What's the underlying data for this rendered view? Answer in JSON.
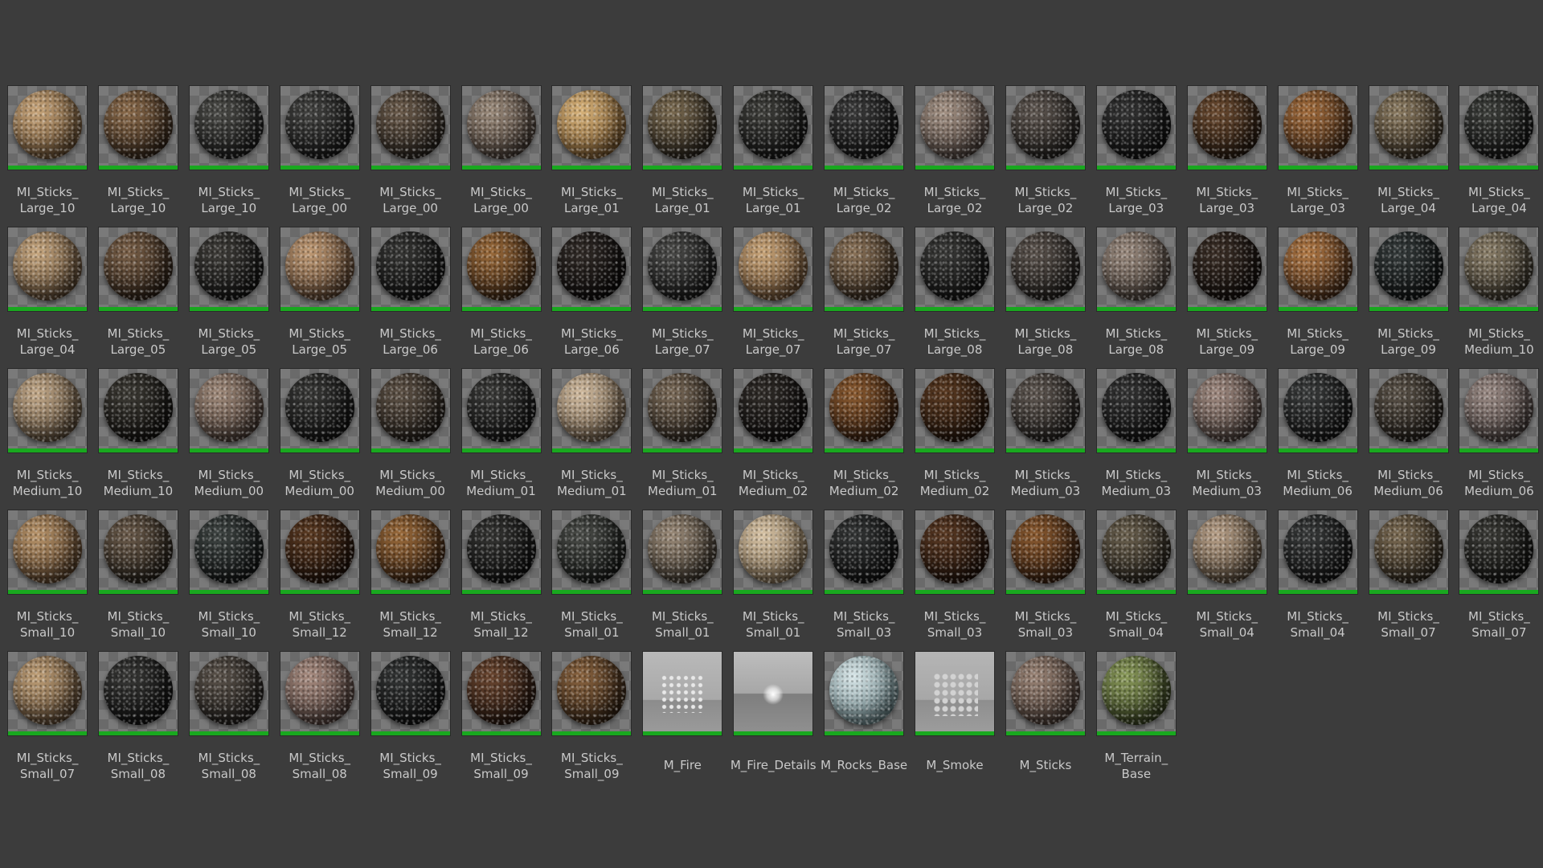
{
  "colors": {
    "background": "#3c3c3c",
    "label_text": "#c9c9c9",
    "asset_type_bar": "#19a81f"
  },
  "assets": [
    {
      "label": "MI_Sticks_\nLarge_10",
      "thumb": "sphere",
      "tone": [
        "#c8a57a",
        "#5b4329"
      ]
    },
    {
      "label": "MI_Sticks_\nLarge_10",
      "thumb": "sphere",
      "tone": [
        "#8a6a4a",
        "#2a1e14"
      ]
    },
    {
      "label": "MI_Sticks_\nLarge_10",
      "thumb": "sphere",
      "tone": [
        "#4a4a46",
        "#151515"
      ]
    },
    {
      "label": "MI_Sticks_\nLarge_00",
      "thumb": "sphere",
      "tone": [
        "#424240",
        "#121212"
      ]
    },
    {
      "label": "MI_Sticks_\nLarge_00",
      "thumb": "sphere",
      "tone": [
        "#6a5a4a",
        "#1e1a16"
      ]
    },
    {
      "label": "MI_Sticks_\nLarge_00",
      "thumb": "sphere",
      "tone": [
        "#9a8a7a",
        "#3a302a"
      ]
    },
    {
      "label": "MI_Sticks_\nLarge_01",
      "thumb": "sphere",
      "tone": [
        "#d8b37a",
        "#6a4a24"
      ]
    },
    {
      "label": "MI_Sticks_\nLarge_01",
      "thumb": "sphere",
      "tone": [
        "#7a6a50",
        "#1e1a14"
      ]
    },
    {
      "label": "MI_Sticks_\nLarge_01",
      "thumb": "sphere",
      "tone": [
        "#3e3e3a",
        "#101010"
      ]
    },
    {
      "label": "MI_Sticks_\nLarge_02",
      "thumb": "sphere",
      "tone": [
        "#3a3a3a",
        "#0e0e0e"
      ]
    },
    {
      "label": "MI_Sticks_\nLarge_02",
      "thumb": "sphere",
      "tone": [
        "#a49284",
        "#3e3430"
      ]
    },
    {
      "label": "MI_Sticks_\nLarge_02",
      "thumb": "sphere",
      "tone": [
        "#5e5650",
        "#1a1816"
      ]
    },
    {
      "label": "MI_Sticks_\nLarge_03",
      "thumb": "sphere",
      "tone": [
        "#343434",
        "#0c0c0c"
      ]
    },
    {
      "label": "MI_Sticks_\nLarge_03",
      "thumb": "sphere",
      "tone": [
        "#6a4a30",
        "#1e140c"
      ]
    },
    {
      "label": "MI_Sticks_\nLarge_03",
      "thumb": "sphere",
      "tone": [
        "#a06a3a",
        "#3a2414"
      ]
    },
    {
      "label": "MI_Sticks_\nLarge_04",
      "thumb": "sphere",
      "tone": [
        "#8a7a60",
        "#2a2218"
      ]
    },
    {
      "label": "MI_Sticks_\nLarge_04",
      "thumb": "sphere",
      "tone": [
        "#3c3e3a",
        "#0e0e0e"
      ]
    },
    {
      "label": "MI_Sticks_\nLarge_04",
      "thumb": "sphere",
      "tone": [
        "#c8a880",
        "#4a3826"
      ]
    },
    {
      "label": "MI_Sticks_\nLarge_05",
      "thumb": "sphere",
      "tone": [
        "#7a6048",
        "#221810"
      ]
    },
    {
      "label": "MI_Sticks_\nLarge_05",
      "thumb": "sphere",
      "tone": [
        "#3e3c38",
        "#0e0e0e"
      ]
    },
    {
      "label": "MI_Sticks_\nLarge_05",
      "thumb": "sphere",
      "tone": [
        "#c09a74",
        "#4a3424"
      ]
    },
    {
      "label": "MI_Sticks_\nLarge_06",
      "thumb": "sphere",
      "tone": [
        "#363634",
        "#0c0c0c"
      ]
    },
    {
      "label": "MI_Sticks_\nLarge_06",
      "thumb": "sphere",
      "tone": [
        "#9a6a3a",
        "#2e1c0e"
      ]
    },
    {
      "label": "MI_Sticks_\nLarge_06",
      "thumb": "sphere",
      "tone": [
        "#302a26",
        "#0a0808"
      ]
    },
    {
      "label": "MI_Sticks_\nLarge_07",
      "thumb": "sphere",
      "tone": [
        "#4a4a48",
        "#121212"
      ]
    },
    {
      "label": "MI_Sticks_\nLarge_07",
      "thumb": "sphere",
      "tone": [
        "#c8a478",
        "#5a4028"
      ]
    },
    {
      "label": "MI_Sticks_\nLarge_07",
      "thumb": "sphere",
      "tone": [
        "#8a7258",
        "#2a2016"
      ]
    },
    {
      "label": "MI_Sticks_\nLarge_08",
      "thumb": "sphere",
      "tone": [
        "#3a3a38",
        "#0e0e0e"
      ]
    },
    {
      "label": "MI_Sticks_\nLarge_08",
      "thumb": "sphere",
      "tone": [
        "#5a524c",
        "#181614"
      ]
    },
    {
      "label": "MI_Sticks_\nLarge_08",
      "thumb": "sphere",
      "tone": [
        "#9a8a7e",
        "#3a322c"
      ]
    },
    {
      "label": "MI_Sticks_\nLarge_09",
      "thumb": "sphere",
      "tone": [
        "#3a2e26",
        "#0e0a08"
      ]
    },
    {
      "label": "MI_Sticks_\nLarge_09",
      "thumb": "sphere",
      "tone": [
        "#b07844",
        "#3a2212"
      ]
    },
    {
      "label": "MI_Sticks_\nLarge_09",
      "thumb": "sphere",
      "tone": [
        "#343a3a",
        "#0c0e0e"
      ]
    },
    {
      "label": "MI_Sticks_\nMedium_10",
      "thumb": "sphere",
      "tone": [
        "#8a7e68",
        "#2a261e"
      ]
    },
    {
      "label": "MI_Sticks_\nMedium_10",
      "thumb": "sphere",
      "tone": [
        "#c4aa8a",
        "#4a3c2c"
      ]
    },
    {
      "label": "MI_Sticks_\nMedium_10",
      "thumb": "sphere",
      "tone": [
        "#3c3a34",
        "#0e0c0a"
      ]
    },
    {
      "label": "MI_Sticks_\nMedium_00",
      "thumb": "sphere",
      "tone": [
        "#a08a7a",
        "#3a2e28"
      ]
    },
    {
      "label": "MI_Sticks_\nMedium_00",
      "thumb": "sphere",
      "tone": [
        "#383836",
        "#0e0e0e"
      ]
    },
    {
      "label": "MI_Sticks_\nMedium_00",
      "thumb": "sphere",
      "tone": [
        "#5e5246",
        "#1a1612"
      ]
    },
    {
      "label": "MI_Sticks_\nMedium_01",
      "thumb": "sphere",
      "tone": [
        "#3a3a38",
        "#0e0e0e"
      ]
    },
    {
      "label": "MI_Sticks_\nMedium_01",
      "thumb": "sphere",
      "tone": [
        "#d2bca0",
        "#5a4a38"
      ]
    },
    {
      "label": "MI_Sticks_\nMedium_01",
      "thumb": "sphere",
      "tone": [
        "#7a6a58",
        "#221c16"
      ]
    },
    {
      "label": "MI_Sticks_\nMedium_02",
      "thumb": "sphere",
      "tone": [
        "#302c28",
        "#0a0808"
      ]
    },
    {
      "label": "MI_Sticks_\nMedium_02",
      "thumb": "sphere",
      "tone": [
        "#8a5a30",
        "#2a160a"
      ]
    },
    {
      "label": "MI_Sticks_\nMedium_02",
      "thumb": "sphere",
      "tone": [
        "#5a3a22",
        "#1a0e06"
      ]
    },
    {
      "label": "MI_Sticks_\nMedium_03",
      "thumb": "sphere",
      "tone": [
        "#5e5650",
        "#1a1816"
      ]
    },
    {
      "label": "MI_Sticks_\nMedium_03",
      "thumb": "sphere",
      "tone": [
        "#343434",
        "#0c0c0c"
      ]
    },
    {
      "label": "MI_Sticks_\nMedium_03",
      "thumb": "sphere",
      "tone": [
        "#a08a80",
        "#3a302c"
      ]
    },
    {
      "label": "MI_Sticks_\nMedium_06",
      "thumb": "sphere",
      "tone": [
        "#3a3c3c",
        "#0e0e0e"
      ]
    },
    {
      "label": "MI_Sticks_\nMedium_06",
      "thumb": "sphere",
      "tone": [
        "#5a5248",
        "#181410"
      ]
    },
    {
      "label": "MI_Sticks_\nMedium_06",
      "thumb": "sphere",
      "tone": [
        "#9a8a84",
        "#3a3230"
      ]
    },
    {
      "label": "MI_Sticks_\nSmall_10",
      "thumb": "sphere",
      "tone": [
        "#b8946a",
        "#4a3420"
      ]
    },
    {
      "label": "MI_Sticks_\nSmall_10",
      "thumb": "sphere",
      "tone": [
        "#6a5a4a",
        "#1c1812"
      ]
    },
    {
      "label": "MI_Sticks_\nSmall_10",
      "thumb": "sphere",
      "tone": [
        "#3e4442",
        "#0e1010"
      ]
    },
    {
      "label": "MI_Sticks_\nSmall_12",
      "thumb": "sphere",
      "tone": [
        "#5a3a22",
        "#180c06"
      ]
    },
    {
      "label": "MI_Sticks_\nSmall_12",
      "thumb": "sphere",
      "tone": [
        "#9a6a3a",
        "#2e1a0c"
      ]
    },
    {
      "label": "MI_Sticks_\nSmall_12",
      "thumb": "sphere",
      "tone": [
        "#343432",
        "#0c0c0c"
      ]
    },
    {
      "label": "MI_Sticks_\nSmall_01",
      "thumb": "sphere",
      "tone": [
        "#4a4c48",
        "#121412"
      ]
    },
    {
      "label": "MI_Sticks_\nSmall_01",
      "thumb": "sphere",
      "tone": [
        "#9a8a78",
        "#302a22"
      ]
    },
    {
      "label": "MI_Sticks_\nSmall_01",
      "thumb": "sphere",
      "tone": [
        "#d8c4a6",
        "#6a5840"
      ]
    },
    {
      "label": "MI_Sticks_\nSmall_03",
      "thumb": "sphere",
      "tone": [
        "#343636",
        "#0c0c0c"
      ]
    },
    {
      "label": "MI_Sticks_\nSmall_03",
      "thumb": "sphere",
      "tone": [
        "#5a3a24",
        "#180c06"
      ]
    },
    {
      "label": "MI_Sticks_\nSmall_03",
      "thumb": "sphere",
      "tone": [
        "#8a5a30",
        "#2a160a"
      ]
    },
    {
      "label": "MI_Sticks_\nSmall_04",
      "thumb": "sphere",
      "tone": [
        "#6a604e",
        "#1e1a14"
      ]
    },
    {
      "label": "MI_Sticks_\nSmall_04",
      "thumb": "sphere",
      "tone": [
        "#b8a088",
        "#463a2c"
      ]
    },
    {
      "label": "MI_Sticks_\nSmall_04",
      "thumb": "sphere",
      "tone": [
        "#383a3a",
        "#0e0e0e"
      ]
    },
    {
      "label": "MI_Sticks_\nSmall_07",
      "thumb": "sphere",
      "tone": [
        "#7a6a52",
        "#221c14"
      ]
    },
    {
      "label": "MI_Sticks_\nSmall_07",
      "thumb": "sphere",
      "tone": [
        "#3a3a36",
        "#0e0e0c"
      ]
    },
    {
      "label": "MI_Sticks_\nSmall_07",
      "thumb": "sphere",
      "tone": [
        "#c0a078",
        "#4a3826"
      ]
    },
    {
      "label": "MI_Sticks_\nSmall_08",
      "thumb": "sphere",
      "tone": [
        "#383836",
        "#0c0c0c"
      ]
    },
    {
      "label": "MI_Sticks_\nSmall_08",
      "thumb": "sphere",
      "tone": [
        "#5a524a",
        "#181614"
      ]
    },
    {
      "label": "MI_Sticks_\nSmall_08",
      "thumb": "sphere",
      "tone": [
        "#a88c80",
        "#3e302c"
      ]
    },
    {
      "label": "MI_Sticks_\nSmall_09",
      "thumb": "sphere",
      "tone": [
        "#343636",
        "#0c0c0c"
      ]
    },
    {
      "label": "MI_Sticks_\nSmall_09",
      "thumb": "sphere",
      "tone": [
        "#6a4630",
        "#1c100a"
      ]
    },
    {
      "label": "MI_Sticks_\nSmall_09",
      "thumb": "sphere",
      "tone": [
        "#8a6440",
        "#281a0e"
      ]
    },
    {
      "label": "M_Fire",
      "thumb": "fire"
    },
    {
      "label": "M_Fire_Details",
      "thumb": "fire-details"
    },
    {
      "label": "M_Rocks_Base",
      "thumb": "sphere",
      "tone": [
        "#d8e6e8",
        "#5a7478"
      ]
    },
    {
      "label": "M_Smoke",
      "thumb": "smoke"
    },
    {
      "label": "M_Sticks",
      "thumb": "sphere",
      "tone": [
        "#9a8476",
        "#3a2e28"
      ]
    },
    {
      "label": "M_Terrain_\nBase",
      "thumb": "sphere",
      "tone": [
        "#8a9a5a",
        "#2a3218"
      ]
    }
  ]
}
